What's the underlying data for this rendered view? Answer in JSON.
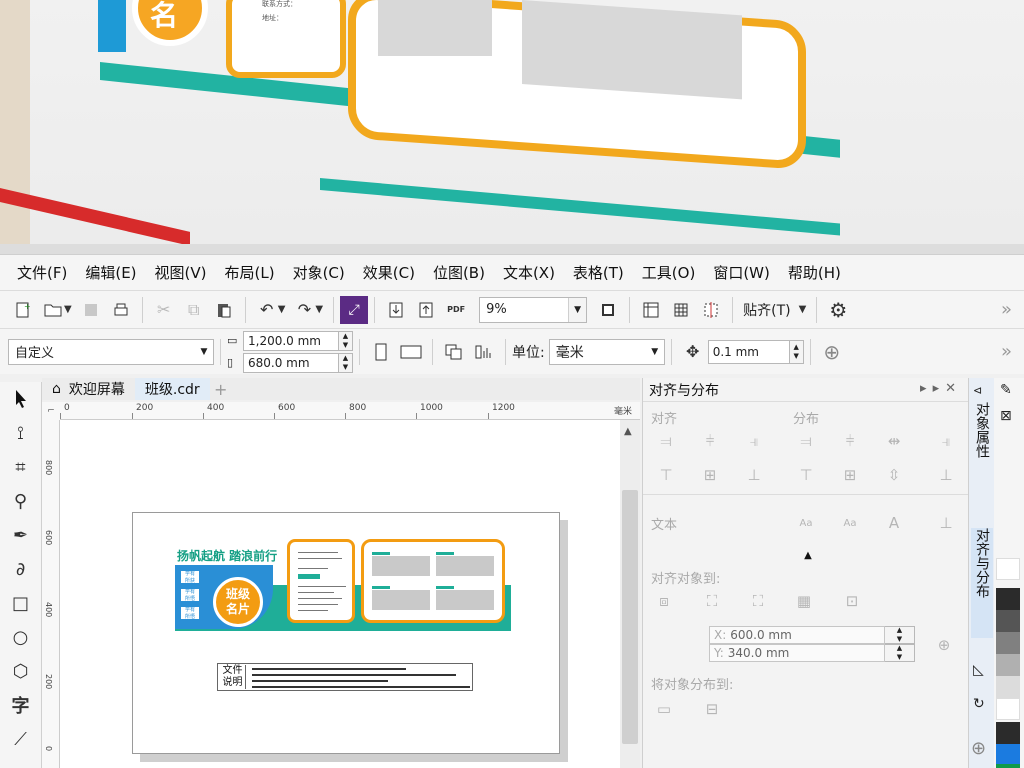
{
  "photo": {
    "badge_text": "名",
    "card_line1": "联系方式：",
    "card_line2": "地址："
  },
  "menubar": [
    {
      "label": "文件(F)"
    },
    {
      "label": "编辑(E)"
    },
    {
      "label": "视图(V)"
    },
    {
      "label": "布局(L)"
    },
    {
      "label": "对象(C)"
    },
    {
      "label": "效果(C)"
    },
    {
      "label": "位图(B)"
    },
    {
      "label": "文本(X)"
    },
    {
      "label": "表格(T)"
    },
    {
      "label": "工具(O)"
    },
    {
      "label": "窗口(W)"
    },
    {
      "label": "帮助(H)"
    }
  ],
  "toolbar": {
    "pdf_label": "PDF",
    "zoom_value": "9%",
    "snap_label": "贴齐(T)",
    "more": "»"
  },
  "propbar": {
    "page_preset": "自定义",
    "width_value": "1,200.0 mm",
    "height_value": "680.0 mm",
    "unit_label": "单位:",
    "unit_value": "毫米",
    "nudge_value": "0.1 mm",
    "more": "»"
  },
  "tabs": {
    "welcome": "欢迎屏幕",
    "doc": "班级.cdr"
  },
  "ruler": {
    "h_labels": [
      "0",
      "200",
      "400",
      "600",
      "800",
      "1000",
      "1200"
    ],
    "v_labels": [
      "800",
      "600",
      "400",
      "200",
      "0"
    ],
    "unit": "毫米"
  },
  "design": {
    "title": "扬帆起航 踏浪前行",
    "circle_text": "班级\n名片",
    "mini_labels": [
      "学有\n所获",
      "学有\n所悟",
      "学有\n所悟"
    ],
    "note_label": "文件\n说明"
  },
  "docker": {
    "title": "对齐与分布",
    "align_section": "对齐",
    "distribute_section": "分布",
    "text_section": "文本",
    "align_to_section": "对齐对象到:",
    "x_label": "X:",
    "x_value": "600.0 mm",
    "y_label": "Y:",
    "y_value": "340.0 mm",
    "distribute_to_section": "将对象分布到:"
  },
  "vtabs": {
    "props": "对象属性",
    "align": "对齐与分布"
  },
  "palette": {
    "colors": [
      "#ffffff",
      "#2b2b2b",
      "#555555",
      "#808080",
      "#b0b0b0",
      "#dcdcdc",
      "#ffffff",
      "#2b2b2b",
      "#1b7be0",
      "#0f9a4a"
    ]
  }
}
